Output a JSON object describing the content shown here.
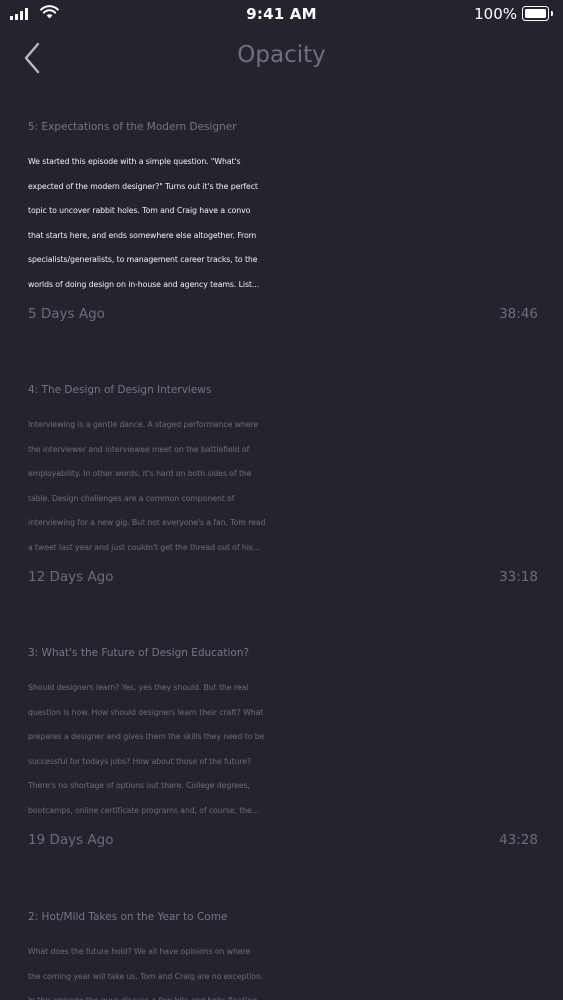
{
  "status_bar": {
    "time": "9:41 AM",
    "battery": "100%",
    "icons": [
      "signal-icon",
      "wifi-icon",
      "battery-icon"
    ]
  },
  "nav": {
    "title": "Opacity",
    "back_icon": "chevron-left-icon"
  },
  "colors": {
    "background": "#24242f",
    "title_text": "#727587",
    "active_text": "#f2f2f5",
    "dim_text": "#6a6d7d"
  },
  "episodes": [
    {
      "title": "5: Expectations of the Modern Designer",
      "lines": [
        "We started this episode with a simple question. \"What's",
        "expected of the modern designer?\" Turns out it's the perfect",
        "topic to uncover rabbit holes.   Tom and Craig have a convo",
        "that starts here, and ends somewhere else altogether. From",
        "specialists/generalists, to management career tracks, to the",
        "worlds of doing design on in-house and agency teams.  List..."
      ],
      "date": "5 Days Ago",
      "duration": "38:46"
    },
    {
      "title": "4: The Design of Design Interviews",
      "lines": [
        "Interviewing is a gentle dance. A staged performance where",
        "the interviewer and interviewee meet on the battlefield of",
        "employability. In other words, it's hard on both sides of the",
        "table.  Design challenges are a common component of",
        "interviewing for a new gig. But not everyone's a fan. Tom read",
        "a tweet last year and just couldn't get the thread out of his..."
      ],
      "date": "12 Days Ago",
      "duration": "33:18"
    },
    {
      "title": "3: What's the Future of Design Education?",
      "lines": [
        "Should designers learn? Yes, yes they should. But the real",
        "question is how. How should designers learn their craft? What",
        "prepares a designer and gives them the skills they need to be",
        "successful for todays jobs? How about those of the future?",
        "There's no shortage of options out there. College degrees,",
        "bootcamps, online certificate programs and, of course, the..."
      ],
      "date": "19 Days Ago",
      "duration": "43:28"
    },
    {
      "title": "2: Hot/Mild Takes on the Year to Come",
      "lines": [
        "What does the future hold? We all have opinions on where",
        "the coming year will take us. Tom and Craig are no exception.",
        "In this episode the guys discuss a few bits and bobs floating"
      ],
      "date": "",
      "duration": ""
    }
  ]
}
